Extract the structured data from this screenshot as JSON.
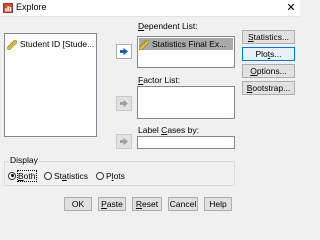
{
  "window": {
    "title": "Explore",
    "close_glyph": "✕",
    "app_icon": "spss-explore-icon"
  },
  "variables": {
    "items": [
      {
        "label": "Student ID [Stude...",
        "icon": "ruler-icon"
      }
    ]
  },
  "dependent": {
    "label_pre": "",
    "label_u": "D",
    "label_post": "ependent List:",
    "items": [
      {
        "label": "Statistics Final Ex...",
        "icon": "ruler-icon",
        "selected": true
      }
    ]
  },
  "factor": {
    "label_u": "F",
    "label_post": "actor List:"
  },
  "label_cases": {
    "label_pre": "Label ",
    "label_u": "C",
    "label_post": "ases by:"
  },
  "side_buttons": [
    {
      "id": "statistics",
      "pre": "",
      "u": "S",
      "post": "tatistics..."
    },
    {
      "id": "plots",
      "pre": "Plo",
      "u": "t",
      "post": "s..."
    },
    {
      "id": "options",
      "pre": "",
      "u": "O",
      "post": "ptions..."
    },
    {
      "id": "bootstrap",
      "pre": "",
      "u": "B",
      "post": "ootstrap..."
    }
  ],
  "display": {
    "label": "Display",
    "options": [
      {
        "pre": "",
        "u": "B",
        "post": "oth",
        "checked": true
      },
      {
        "pre": "St",
        "u": "a",
        "post": "tistics",
        "checked": false
      },
      {
        "pre": "P",
        "u": "l",
        "post": "ots",
        "checked": false
      }
    ]
  },
  "bottom_buttons": [
    {
      "id": "ok",
      "pre": "OK",
      "u": "",
      "post": ""
    },
    {
      "id": "paste",
      "pre": "",
      "u": "P",
      "post": "aste"
    },
    {
      "id": "reset",
      "pre": "",
      "u": "R",
      "post": "eset"
    },
    {
      "id": "cancel",
      "pre": "Cancel",
      "u": "",
      "post": ""
    },
    {
      "id": "help",
      "pre": "Help",
      "u": "",
      "post": ""
    }
  ],
  "colors": {
    "selection": "#a9a9a9",
    "focus_border": "#0078d7",
    "arrow_blue": "#1c5fb8",
    "ruler_yellow": "#e8c94a"
  }
}
